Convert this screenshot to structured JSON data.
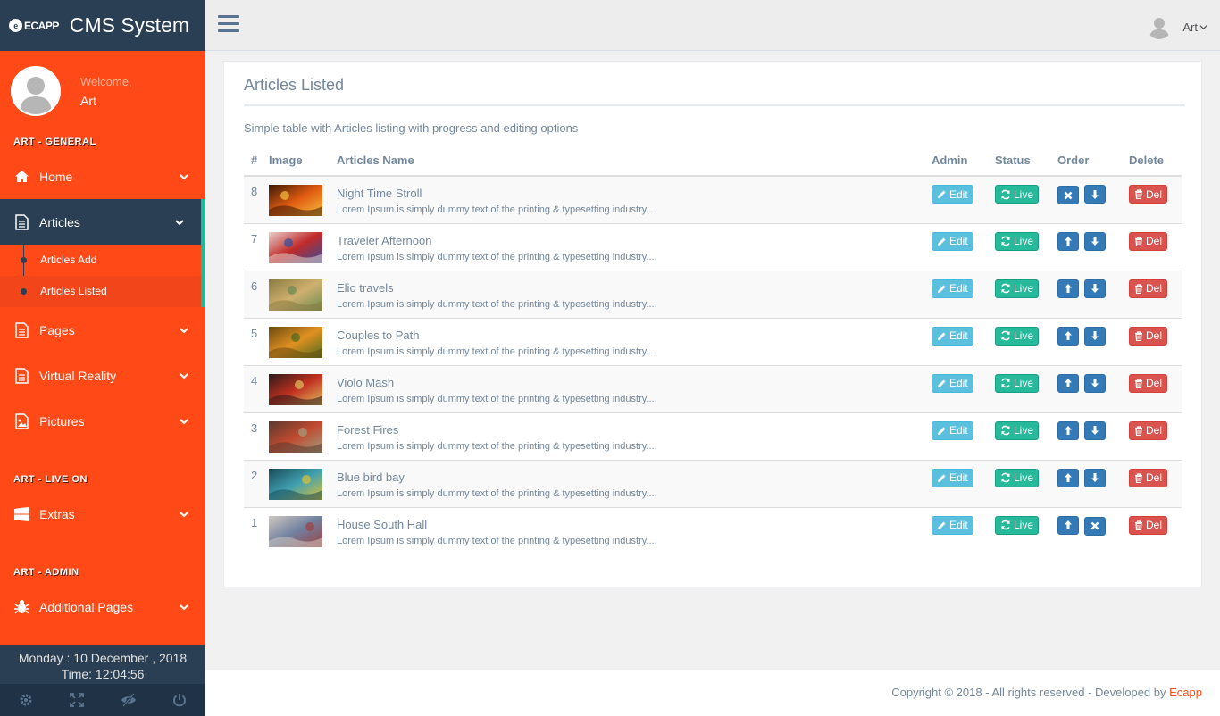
{
  "brand": {
    "logo_text": "ECAPP",
    "title": "CMS System"
  },
  "profile": {
    "welcome": "Welcome,",
    "name": "Art"
  },
  "sidebar": {
    "sections": [
      {
        "title": "ART - GENERAL"
      },
      {
        "title": "ART - LIVE ON"
      },
      {
        "title": "ART - ADMIN"
      }
    ],
    "items": [
      {
        "label": "Home",
        "icon": "home-icon"
      },
      {
        "label": "Articles",
        "icon": "document-icon"
      },
      {
        "label": "Pages",
        "icon": "document-icon"
      },
      {
        "label": "Virtual Reality",
        "icon": "document-icon"
      },
      {
        "label": "Pictures",
        "icon": "picture-icon"
      },
      {
        "label": "Extras",
        "icon": "windows-icon"
      },
      {
        "label": "Additional Pages",
        "icon": "bug-icon"
      }
    ],
    "sub_items": [
      {
        "label": "Articles Add"
      },
      {
        "label": "Articles Listed"
      }
    ],
    "date": "Monday : 10 December , 2018",
    "time": "Time: 12:04:56"
  },
  "topnav": {
    "user": "Art"
  },
  "panel": {
    "title": "Articles Listed",
    "description": "Simple table with Articles listing with progress and editing options",
    "headers": {
      "num": "#",
      "image": "Image",
      "name": "Articles Name",
      "admin": "Admin",
      "status": "Status",
      "order": "Order",
      "delete": "Delete"
    },
    "buttons": {
      "edit": "Edit",
      "live": "Live",
      "del": "Del"
    },
    "rows": [
      {
        "num": "8",
        "title": "Night Time Stroll",
        "desc": "Lorem Ipsum is simply dummy text of the printing & typesetting industry....",
        "order_first": "close",
        "order_second": "down"
      },
      {
        "num": "7",
        "title": "Traveler Afternoon",
        "desc": "Lorem Ipsum is simply dummy text of the printing & typesetting industry....",
        "order_first": "up",
        "order_second": "down"
      },
      {
        "num": "6",
        "title": "Elio travels",
        "desc": "Lorem Ipsum is simply dummy text of the printing & typesetting industry....",
        "order_first": "up",
        "order_second": "down"
      },
      {
        "num": "5",
        "title": "Couples to Path",
        "desc": "Lorem Ipsum is simply dummy text of the printing & typesetting industry....",
        "order_first": "up",
        "order_second": "down"
      },
      {
        "num": "4",
        "title": "Violo Mash",
        "desc": "Lorem Ipsum is simply dummy text of the printing & typesetting industry....",
        "order_first": "up",
        "order_second": "down"
      },
      {
        "num": "3",
        "title": "Forest Fires",
        "desc": "Lorem Ipsum is simply dummy text of the printing & typesetting industry....",
        "order_first": "up",
        "order_second": "down"
      },
      {
        "num": "2",
        "title": "Blue bird bay",
        "desc": "Lorem Ipsum is simply dummy text of the printing & typesetting industry....",
        "order_first": "up",
        "order_second": "down"
      },
      {
        "num": "1",
        "title": "House South Hall",
        "desc": "Lorem Ipsum is simply dummy text of the printing & typesetting industry....",
        "order_first": "up",
        "order_second": "close"
      }
    ]
  },
  "footer": {
    "text": "Copyright © 2018 - All rights reserved - Developed by ",
    "brand": "Ecapp"
  },
  "colors": {
    "sidebar": "#ff4a17",
    "navy": "#2a3f54",
    "accent": "#1abb9c"
  }
}
